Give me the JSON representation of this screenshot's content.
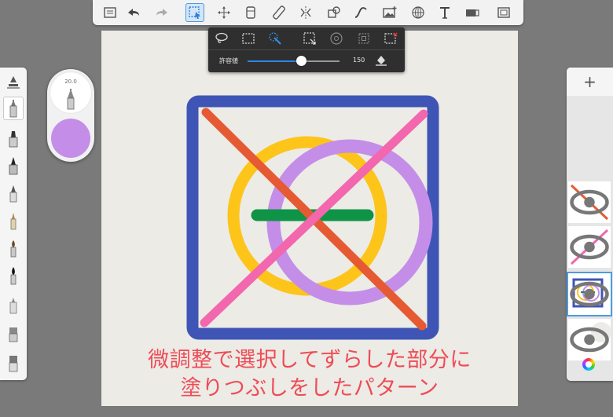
{
  "toolbar": {
    "tools": [
      "list-icon",
      "undo-icon",
      "redo-icon",
      "selection-icon",
      "transform-icon",
      "layers-icon",
      "ruler-icon",
      "symmetry-icon",
      "shapes-icon",
      "curve-icon",
      "image-icon",
      "perspective-icon",
      "text-icon",
      "video-icon",
      "fullscreen-icon"
    ],
    "active_tool": "selection-icon"
  },
  "selection_bar": {
    "tools": [
      "lasso-icon",
      "rect-select-icon",
      "magic-wand-icon",
      "crop-select-icon",
      "circle-select-icon",
      "square-select-icon",
      "clear-select-icon"
    ],
    "tolerance_label": "許容値",
    "tolerance_value": "150",
    "tolerance_fraction": 0.58
  },
  "brush_panel": {
    "brushes": [
      "eraser-brush-icon",
      "pencil-brush-icon",
      "marker-brush-icon",
      "pen-brush-icon",
      "brush-icon",
      "fineliner-icon",
      "paintbrush-icon",
      "ink-brush-icon",
      "airbrush-icon",
      "smudge-icon",
      "fill-icon"
    ],
    "active_index": 1
  },
  "puck": {
    "size_label": "20.0",
    "color": "#c48ee8"
  },
  "layers_panel": {
    "add_label": "+",
    "layers": [
      {
        "name": "layer-red-line",
        "selected": false
      },
      {
        "name": "layer-pink-line",
        "selected": false
      },
      {
        "name": "layer-shapes",
        "selected": true
      },
      {
        "name": "layer-background",
        "selected": false
      }
    ]
  },
  "colors": {
    "blue": "#3f55b5",
    "yellow": "#fdc41a",
    "purple": "#c48ee8",
    "green": "#0f9347",
    "red": "#e65a33",
    "pink": "#f267ad",
    "caption": "#ef4b57",
    "accent": "#4d9be3"
  },
  "caption": {
    "line1": "微調整で選択してずらした部分に",
    "line2": "塗りつぶしをしたパターン"
  }
}
